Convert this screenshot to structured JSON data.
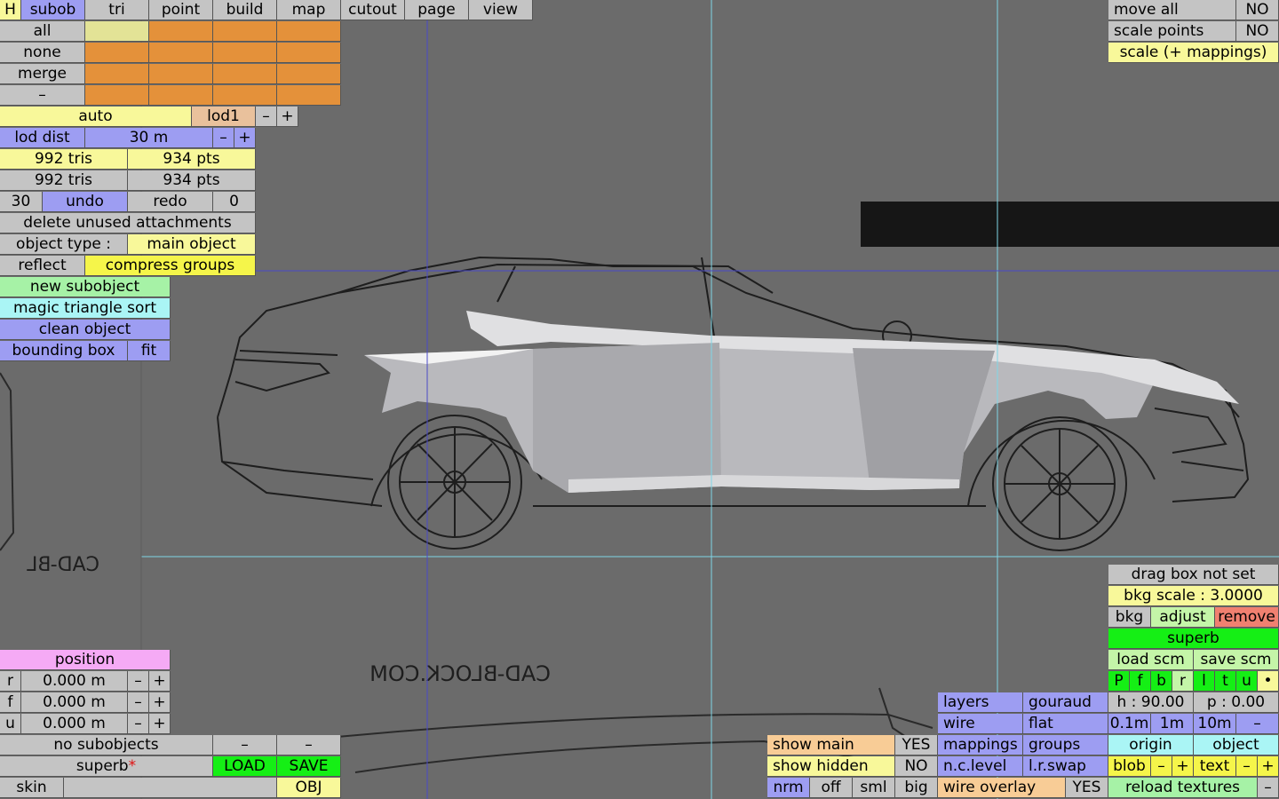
{
  "topbar": {
    "h": "H",
    "subob": "subob",
    "tri": "tri",
    "point": "point",
    "build": "build",
    "map": "map",
    "cutout": "cutout",
    "page": "page",
    "view": "view"
  },
  "select": {
    "all": "all",
    "none": "none",
    "merge": "merge",
    "dash": "–"
  },
  "lod": {
    "auto": "auto",
    "current": "lod1",
    "minus": "–",
    "plus": "+",
    "dist_label": "lod dist",
    "dist_value": "30 m"
  },
  "stats": {
    "tris1": "992 tris",
    "pts1": "934 pts",
    "tris2": "992 tris",
    "pts2": "934 pts"
  },
  "history": {
    "count": "30",
    "undo": "undo",
    "redo": "redo",
    "redo_count": "0"
  },
  "actions": {
    "delete_unused": "delete unused attachments",
    "object_type_label": "object type :",
    "object_type_value": "main object",
    "reflect": "reflect",
    "compress": "compress groups",
    "new_subobject": "new subobject",
    "magic_sort": "magic triangle sort",
    "clean": "clean object",
    "bounding_box": "bounding box",
    "fit": "fit"
  },
  "position": {
    "title": "position",
    "rows": [
      {
        "axis": "r",
        "value": "0.000 m"
      },
      {
        "axis": "f",
        "value": "0.000 m"
      },
      {
        "axis": "u",
        "value": "0.000 m"
      }
    ],
    "minus": "–",
    "plus": "+"
  },
  "file": {
    "no_subobjects": "no subobjects",
    "dash": "–",
    "name": "superb",
    "modified_mark": "*",
    "load": "LOAD",
    "save": "SAVE",
    "skin": "skin",
    "skin_value": "",
    "obj": "OBJ"
  },
  "topright": {
    "move_all": "move all",
    "move_all_value": "NO",
    "scale_points": "scale points",
    "scale_points_value": "NO",
    "scale_mappings": "scale (+ mappings)"
  },
  "bottomright": {
    "drag_box": "drag box not set",
    "bkg_scale": "bkg scale : 3.0000",
    "bkg": "bkg",
    "adjust": "adjust",
    "remove": "remove",
    "superb": "superb",
    "load_scm": "load scm",
    "save_scm": "save scm",
    "views": [
      "P",
      "f",
      "b",
      "r",
      "l",
      "t",
      "u",
      "•"
    ],
    "h_angle": "h : 90.00",
    "p_angle": "p : 0.00",
    "grid": [
      "0.1m",
      "1m",
      "10m",
      "–"
    ],
    "origin": "origin",
    "object": "object",
    "blob": "blob",
    "text": "text",
    "minus": "–",
    "plus": "+",
    "reload_textures": "reload textures",
    "reload_dash": "–"
  },
  "render": {
    "layers": "layers",
    "gouraud": "gouraud",
    "wire": "wire",
    "flat": "flat",
    "mappings": "mappings",
    "groups": "groups",
    "nclevel": "n.c.level",
    "lrswap": "l.r.swap",
    "wire_overlay": "wire overlay",
    "wire_overlay_value": "YES"
  },
  "show": {
    "show_main": "show main",
    "show_main_value": "YES",
    "show_hidden": "show hidden",
    "show_hidden_value": "NO",
    "nrm": "nrm",
    "off": "off",
    "sml": "sml",
    "big": "big"
  },
  "background_watermark": "CAD-BLOCK.COM",
  "background_watermark_mirror": "CAD-BL"
}
